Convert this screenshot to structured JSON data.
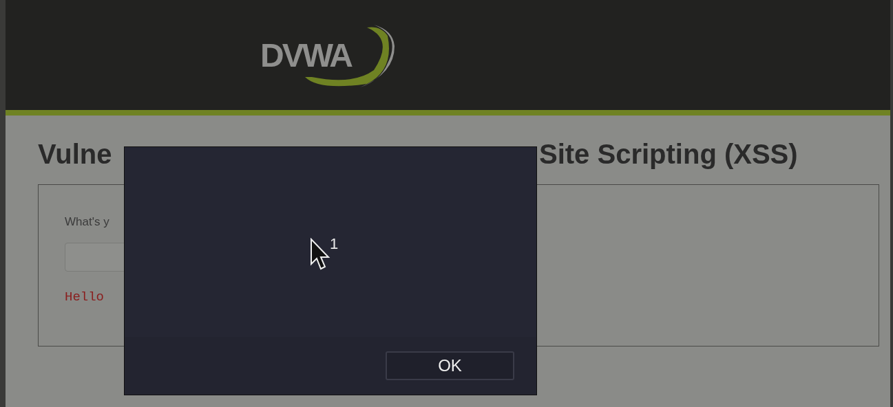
{
  "header": {
    "logo": "DVWA"
  },
  "page": {
    "title_parts": [
      "Vulne",
      "Site Scripting (XSS)"
    ],
    "prompt": "What's y",
    "greeting": "Hello"
  },
  "dialog": {
    "message": "1",
    "buttons": [
      "OK"
    ]
  }
}
